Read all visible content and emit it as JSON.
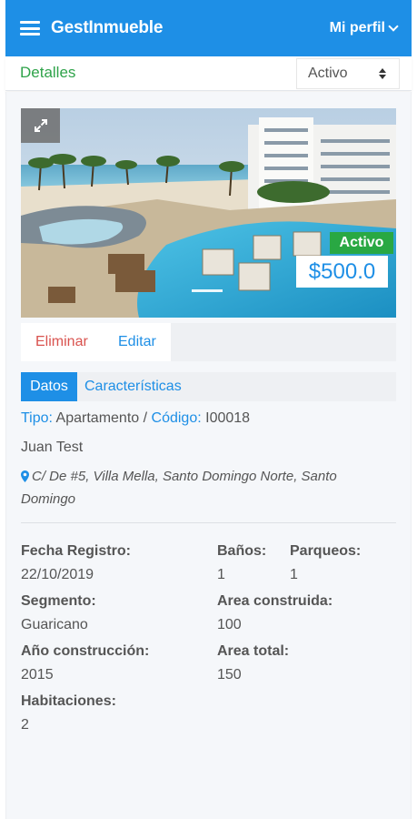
{
  "navbar": {
    "brand": "GestInmueble",
    "profile_label": "Mi perfil"
  },
  "subheader": {
    "title": "Detalles",
    "status_value": "Activo"
  },
  "listing": {
    "badge": "Activo",
    "price": "$500.0",
    "actions": {
      "delete": "Eliminar",
      "edit": "Editar"
    },
    "tabs": {
      "active": "Datos",
      "inactive": "Características"
    },
    "type_label": "Tipo:",
    "type_value": "Apartamento",
    "separator": "/",
    "code_label": "Código:",
    "code_value": "I00018",
    "owner": "Juan Test",
    "address": "C/ De #5, Villa Mella, Santo Domingo Norte, Santo Domingo"
  },
  "details": {
    "fecha_registro": {
      "label": "Fecha Registro:",
      "value": "22/10/2019"
    },
    "banos": {
      "label": "Baños:",
      "value": "1"
    },
    "parqueos": {
      "label": "Parqueos:",
      "value": "1"
    },
    "segmento": {
      "label": "Segmento:",
      "value": "Guaricano"
    },
    "area_construida": {
      "label": "Area construida:",
      "value": "100"
    },
    "anio_construccion": {
      "label": "Año construcción:",
      "value": "2015"
    },
    "area_total": {
      "label": "Area total:",
      "value": "150"
    },
    "habitaciones": {
      "label": "Habitaciones:",
      "value": "2"
    }
  },
  "colors": {
    "primary": "#1e8fe6",
    "success": "#29a843",
    "danger": "#d9534f",
    "title_green": "#2fa34a"
  },
  "icons": {
    "menu": "hamburger-menu-icon",
    "profile_caret": "chevron-down-icon",
    "select_arrows": "sort-arrows-icon",
    "expand": "expand-icon",
    "location": "map-marker-icon"
  }
}
